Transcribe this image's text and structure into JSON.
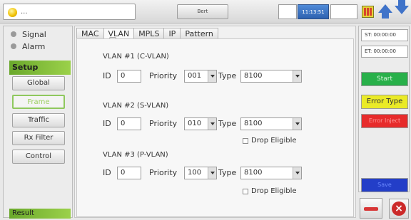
{
  "topbar": {
    "status_text": "...",
    "tab_label": "Bert",
    "clock": "11:13:51"
  },
  "left": {
    "indicators": [
      {
        "label": "Signal"
      },
      {
        "label": "Alarm"
      }
    ],
    "setup_label": "Setup",
    "menu": [
      {
        "label": "Global"
      },
      {
        "label": "Frame"
      },
      {
        "label": "Traffic"
      },
      {
        "label": "Rx Filter"
      },
      {
        "label": "Control"
      }
    ],
    "result_label": "Result"
  },
  "tabs": [
    {
      "label": "MAC"
    },
    {
      "label": "VLAN"
    },
    {
      "label": "MPLS"
    },
    {
      "label": "IP"
    },
    {
      "label": "Pattern"
    }
  ],
  "vlans": [
    {
      "title": "VLAN #1 (C-VLAN)",
      "id_label": "ID",
      "id": "0",
      "priority_label": "Priority",
      "priority": "001",
      "type_label": "Type",
      "type": "8100"
    },
    {
      "title": "VLAN #2 (S-VLAN)",
      "id_label": "ID",
      "id": "0",
      "priority_label": "Priority",
      "priority": "010",
      "type_label": "Type",
      "type": "8100",
      "drop": "Drop Eligible"
    },
    {
      "title": "VLAN #3 (P-VLAN)",
      "id_label": "ID",
      "id": "0",
      "priority_label": "Priority",
      "priority": "100",
      "type_label": "Type",
      "type": "8100",
      "drop": "Drop Eligible"
    }
  ],
  "right": {
    "st": "ST: 00:00:00",
    "et": "ET: 00:00:00",
    "start": "Start",
    "error_type": "Error Type",
    "error_inject": "Error Inject",
    "save": "Save"
  }
}
